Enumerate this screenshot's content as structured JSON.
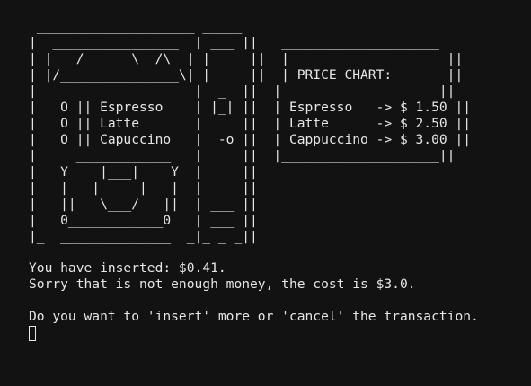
{
  "ascii_art": [
    " ____________________ _____",
    "|  ________________  | ___ ||   ____________________",
    "| |___/      \\__/\\  | | ___ ||  |                    ||",
    "| |/_______________\\| |     ||  | PRICE CHART:       ||",
    "|                    |  _  ||  |                    ||",
    "|   O || Espresso    | |_| ||  | Espresso   -> $ 1.50 ||",
    "|   O || Latte       |     ||  | Latte      -> $ 2.50 ||",
    "|   O || Capuccino   |  -o ||  | Cappuccino -> $ 3.00 ||",
    "|     ____________   |     ||  |____________________||",
    "|   Y    |___|    Y  |     ||",
    "|   |   |     |   |  |     ||",
    "|   ||   \\___/   ||  | ___ ||",
    "|   0____________0   | ___ ||",
    "|_  ______________  _|_ _ _||"
  ],
  "output_lines": [
    "You have inserted: $0.41.",
    "Sorry that is not enough money, the cost is $3.0.",
    "",
    "Do you want to 'insert' more or 'cancel' the transaction."
  ]
}
